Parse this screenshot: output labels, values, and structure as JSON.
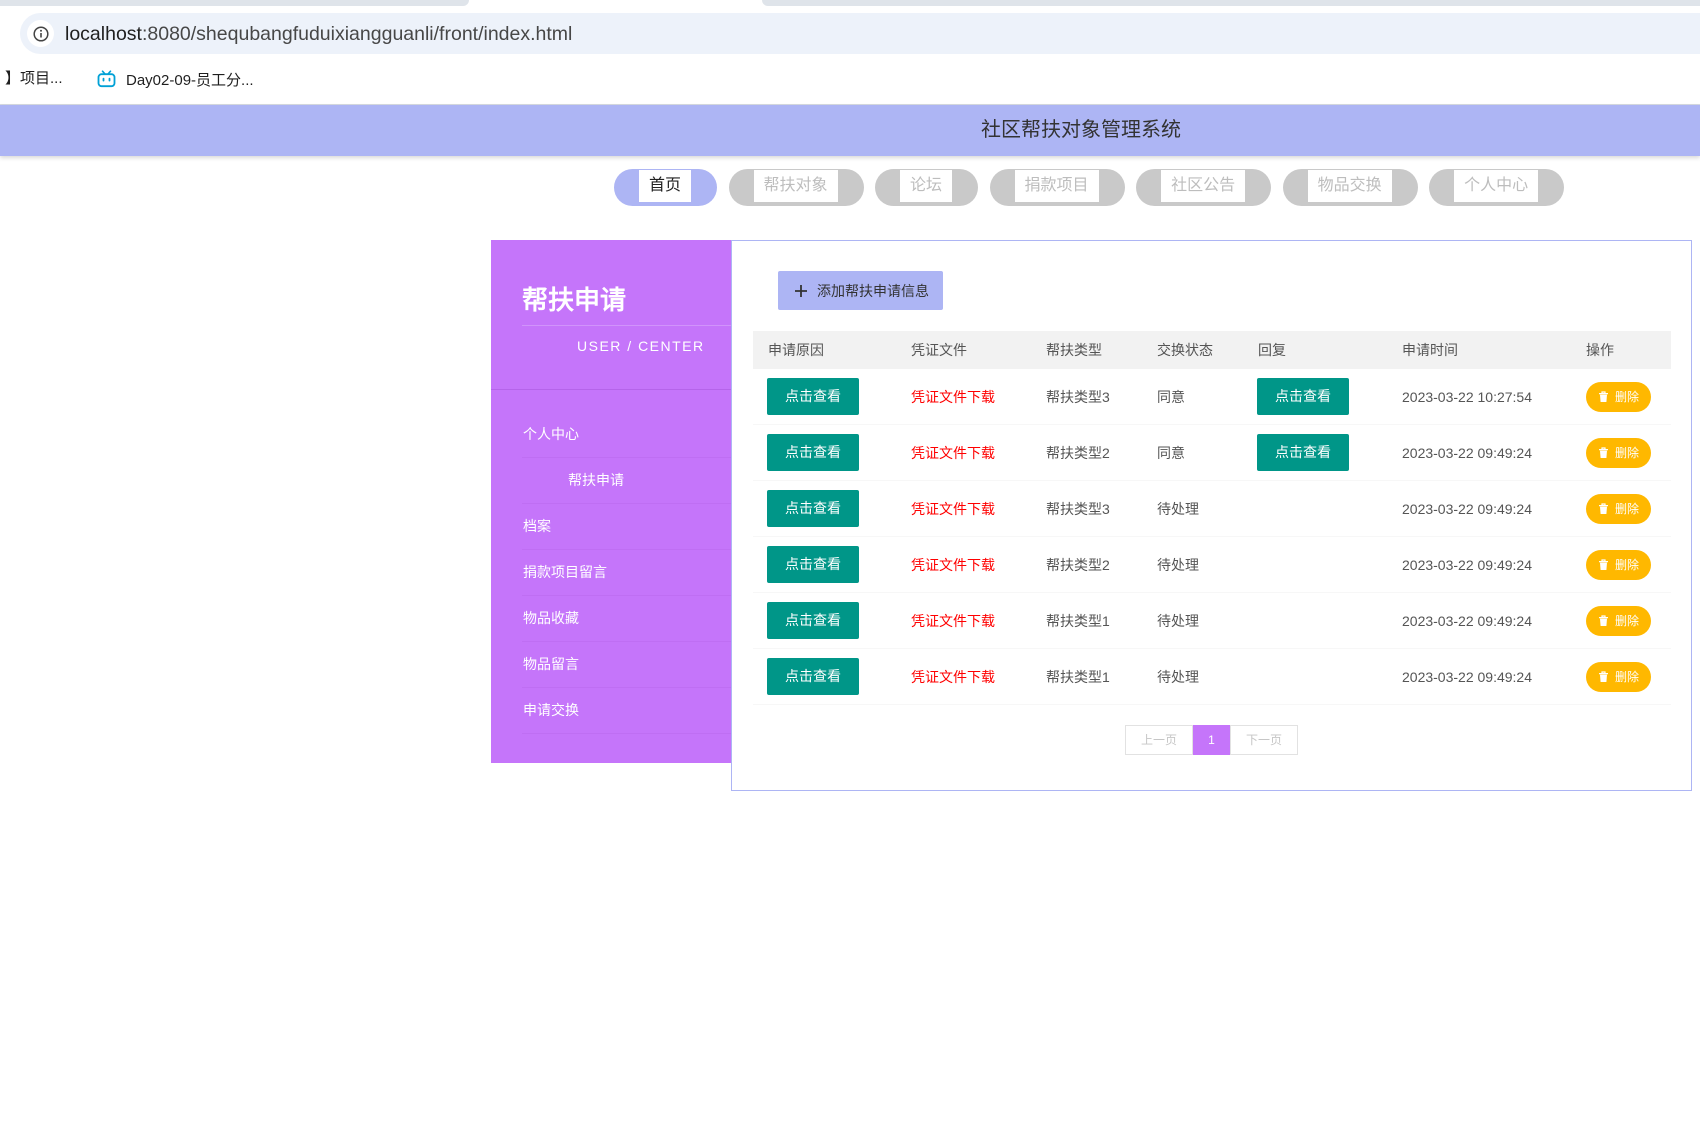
{
  "colors": {
    "accent": "#adb5f4",
    "sidebar": "#c575fa",
    "primary_button": "#009688",
    "warning_button": "#ffb800",
    "link_red": "#ff0000"
  },
  "browser": {
    "url_host": "localhost",
    "url_path": ":8080/shequbangfuduixiangguanli/front/index.html",
    "info_icon": "info-icon",
    "bookmarks": [
      {
        "label": "】项目..."
      },
      {
        "label": "Day02-09-员工分...",
        "icon": "bilibili-tv-icon"
      }
    ]
  },
  "header": {
    "title": "社区帮扶对象管理系统"
  },
  "nav": [
    {
      "label": "首页",
      "active": true
    },
    {
      "label": "帮扶对象",
      "active": false
    },
    {
      "label": "论坛",
      "active": false
    },
    {
      "label": "捐款项目",
      "active": false
    },
    {
      "label": "社区公告",
      "active": false
    },
    {
      "label": "物品交换",
      "active": false
    },
    {
      "label": "个人中心",
      "active": false
    }
  ],
  "sidebar": {
    "title": "帮扶申请",
    "subtitle": "USER / CENTER",
    "items": [
      {
        "label": "个人中心"
      },
      {
        "label": "帮扶申请"
      },
      {
        "label": "档案"
      },
      {
        "label": "捐款项目留言"
      },
      {
        "label": "物品收藏"
      },
      {
        "label": "物品留言"
      },
      {
        "label": "申请交换"
      }
    ]
  },
  "main": {
    "add_button": {
      "label": "添加帮扶申请信息",
      "icon": "plus-icon"
    },
    "columns": [
      "申请原因",
      "凭证文件",
      "帮扶类型",
      "交换状态",
      "回复",
      "申请时间",
      "操作"
    ],
    "delete_icon": "trash-icon",
    "rows": [
      {
        "reason": "点击查看",
        "file": "凭证文件下载",
        "type": "帮扶类型3",
        "status": "同意",
        "reply": "点击查看",
        "time": "2023-03-22 10:27:54",
        "action": "删除"
      },
      {
        "reason": "点击查看",
        "file": "凭证文件下载",
        "type": "帮扶类型2",
        "status": "同意",
        "reply": "点击查看",
        "time": "2023-03-22 09:49:24",
        "action": "删除"
      },
      {
        "reason": "点击查看",
        "file": "凭证文件下载",
        "type": "帮扶类型3",
        "status": "待处理",
        "time": "2023-03-22 09:49:24",
        "action": "删除"
      },
      {
        "reason": "点击查看",
        "file": "凭证文件下载",
        "type": "帮扶类型2",
        "status": "待处理",
        "time": "2023-03-22 09:49:24",
        "action": "删除"
      },
      {
        "reason": "点击查看",
        "file": "凭证文件下载",
        "type": "帮扶类型1",
        "status": "待处理",
        "time": "2023-03-22 09:49:24",
        "action": "删除"
      },
      {
        "reason": "点击查看",
        "file": "凭证文件下载",
        "type": "帮扶类型1",
        "status": "待处理",
        "time": "2023-03-22 09:49:24",
        "action": "删除"
      }
    ],
    "pagination": {
      "prev": "上一页",
      "current": "1",
      "next": "下一页"
    }
  }
}
